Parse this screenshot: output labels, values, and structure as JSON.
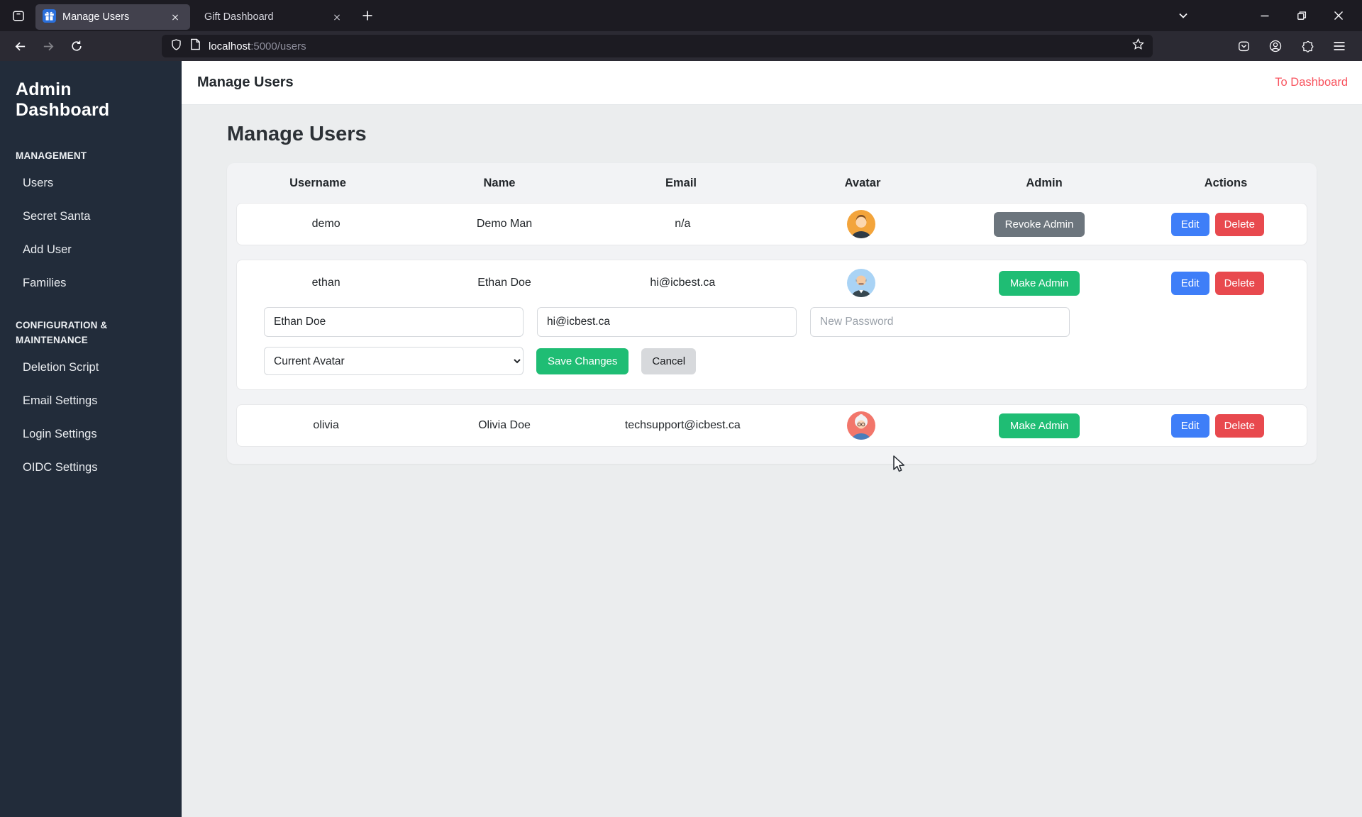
{
  "browser": {
    "tabs": [
      {
        "title": "Manage Users",
        "active": true
      },
      {
        "title": "Gift Dashboard",
        "active": false
      }
    ],
    "url": {
      "host": "localhost",
      "rest": ":5000/users"
    }
  },
  "sidebar": {
    "title": "Admin Dashboard",
    "sections": [
      {
        "label": "MANAGEMENT",
        "items": [
          "Users",
          "Secret Santa",
          "Add User",
          "Families"
        ]
      },
      {
        "label": "CONFIGURATION & MAINTENANCE",
        "items": [
          "Deletion Script",
          "Email Settings",
          "Login Settings",
          "OIDC Settings"
        ]
      }
    ]
  },
  "header": {
    "title": "Manage Users",
    "link": "To Dashboard"
  },
  "page": {
    "title": "Manage Users"
  },
  "table": {
    "columns": [
      "Username",
      "Name",
      "Email",
      "Avatar",
      "Admin",
      "Actions"
    ],
    "users": [
      {
        "username": "demo",
        "name": "Demo Man",
        "email": "n/a",
        "admin_label": "Revoke Admin",
        "avatar_bg": "#f3a43b"
      },
      {
        "username": "ethan",
        "name": "Ethan Doe",
        "email": "hi@icbest.ca",
        "admin_label": "Make Admin",
        "avatar_bg": "#a9d3f5"
      },
      {
        "username": "olivia",
        "name": "Olivia Doe",
        "email": "techsupport@icbest.ca",
        "admin_label": "Make Admin",
        "avatar_bg": "#f2766b"
      }
    ]
  },
  "actions": {
    "edit": "Edit",
    "delete": "Delete"
  },
  "edit_form": {
    "name_value": "Ethan Doe",
    "email_value": "hi@icbest.ca",
    "password_placeholder": "New Password",
    "avatar_select_value": "Current Avatar",
    "save_label": "Save Changes",
    "cancel_label": "Cancel"
  },
  "colors": {
    "primary_blue": "#3e7ef8",
    "danger_red": "#e8494e",
    "success_green": "#1fbd74",
    "secondary_gray": "#6c757d",
    "link_red": "#f8545f",
    "sidebar_bg": "#222c3a",
    "favicon_blue": "#2a6fdb"
  }
}
